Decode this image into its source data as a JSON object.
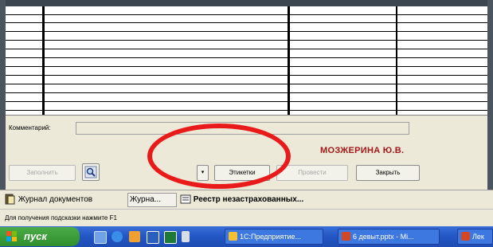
{
  "grid": {
    "rows": 12,
    "columns": 4
  },
  "comment": {
    "label": "Комментарий:",
    "value": ""
  },
  "user_name": "МОЗЖЕРИНА Ю.В.",
  "buttons": {
    "fill": "Заполнить",
    "dropdown": "▾",
    "labels": "Этикетки",
    "post": "Провести",
    "close": "Закрыть"
  },
  "icons": {
    "search": "magnifier-icon",
    "journal": "journal-icon",
    "register": "register-icon",
    "start": "windows-flag-icon"
  },
  "mdi_tabs": [
    {
      "label": "Журнал документов"
    },
    {
      "label": "Журна..."
    },
    {
      "label": "Реестр незастрахованных..."
    }
  ],
  "status_text": "Для получения подсказки нажмите F1",
  "taskbar": {
    "start_label": "пуск",
    "tasks": [
      {
        "label": "1С:Предприятие..."
      },
      {
        "label": "6 девыт.pptx - Mi..."
      },
      {
        "label": "Лек"
      }
    ]
  },
  "colors": {
    "accent_name": "#a01818",
    "highlight_circle": "#e81a1a",
    "taskbar": "#2457c5",
    "start": "#2f8f2c"
  }
}
